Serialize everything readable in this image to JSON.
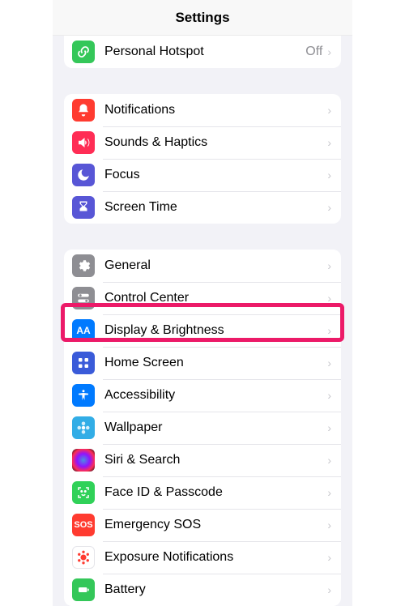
{
  "header": {
    "title": "Settings"
  },
  "groups": [
    {
      "rows": [
        {
          "id": "personal-hotspot",
          "label": "Personal Hotspot",
          "value": "Off",
          "icon": "link-icon",
          "color": "c-green"
        }
      ]
    },
    {
      "rows": [
        {
          "id": "notifications",
          "label": "Notifications",
          "icon": "bell-icon",
          "color": "c-red"
        },
        {
          "id": "sounds-haptics",
          "label": "Sounds & Haptics",
          "icon": "speaker-icon",
          "color": "c-pink"
        },
        {
          "id": "focus",
          "label": "Focus",
          "icon": "moon-icon",
          "color": "c-indigo"
        },
        {
          "id": "screen-time",
          "label": "Screen Time",
          "icon": "hourglass-icon",
          "color": "c-indigo"
        }
      ]
    },
    {
      "rows": [
        {
          "id": "general",
          "label": "General",
          "icon": "gear-icon",
          "color": "c-gray"
        },
        {
          "id": "control-center",
          "label": "Control Center",
          "icon": "switch-icon",
          "color": "c-gray"
        },
        {
          "id": "display-brightness",
          "label": "Display & Brightness",
          "icon": "aa-icon",
          "color": "c-blue",
          "highlight": true
        },
        {
          "id": "home-screen",
          "label": "Home Screen",
          "icon": "grid-icon",
          "color": "c-blue"
        },
        {
          "id": "accessibility",
          "label": "Accessibility",
          "icon": "accessibility-icon",
          "color": "c-blue"
        },
        {
          "id": "wallpaper",
          "label": "Wallpaper",
          "icon": "flower-icon",
          "color": "c-cyan"
        },
        {
          "id": "siri-search",
          "label": "Siri & Search",
          "icon": "siri-icon",
          "color": "c-black"
        },
        {
          "id": "faceid-passcode",
          "label": "Face ID & Passcode",
          "icon": "faceid-icon",
          "color": "c-greenfid"
        },
        {
          "id": "emergency-sos",
          "label": "Emergency SOS",
          "icon": "sos-icon",
          "color": "c-sos"
        },
        {
          "id": "exposure-notifications",
          "label": "Exposure Notifications",
          "icon": "exposure-icon",
          "color": "c-white"
        },
        {
          "id": "battery",
          "label": "Battery",
          "icon": "battery-icon",
          "color": "c-green"
        }
      ]
    }
  ],
  "sos_text": "SOS"
}
